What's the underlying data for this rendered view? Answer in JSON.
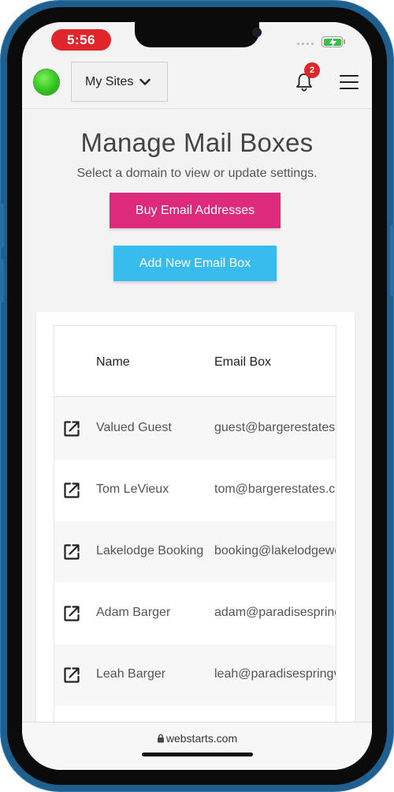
{
  "status_bar": {
    "time": "5:56",
    "notch_label": "",
    "battery_color": "#39c04a"
  },
  "navbar": {
    "status_color": "#2fc019",
    "sites_label": "My Sites",
    "notification_count": "2",
    "icons": [
      "chevron-down-icon",
      "bell-icon",
      "hamburger-menu-icon"
    ]
  },
  "page": {
    "title": "Manage Mail Boxes",
    "subtitle": "Select a domain to view or update settings.",
    "buy_button": "Buy Email Addresses",
    "add_button": "Add New Email Box",
    "buy_color": "#de2a7c",
    "add_color": "#38bced"
  },
  "table": {
    "headers": [
      "",
      "Name",
      "Email Box"
    ],
    "rows": [
      {
        "name": "Valued Guest",
        "email": "guest@bargerestates."
      },
      {
        "name": "Tom LeVieux",
        "email": "tom@bargerestates.co"
      },
      {
        "name": "Lakelodge Booking",
        "email": "booking@lakelodgewe"
      },
      {
        "name": "Adam Barger",
        "email": "adam@paradisespring"
      },
      {
        "name": "Leah Barger",
        "email": "leah@paradisespringv"
      }
    ],
    "row_icon": "edit-icon"
  },
  "browser": {
    "url": "webstarts.com",
    "lock_icon": "lock-icon"
  }
}
